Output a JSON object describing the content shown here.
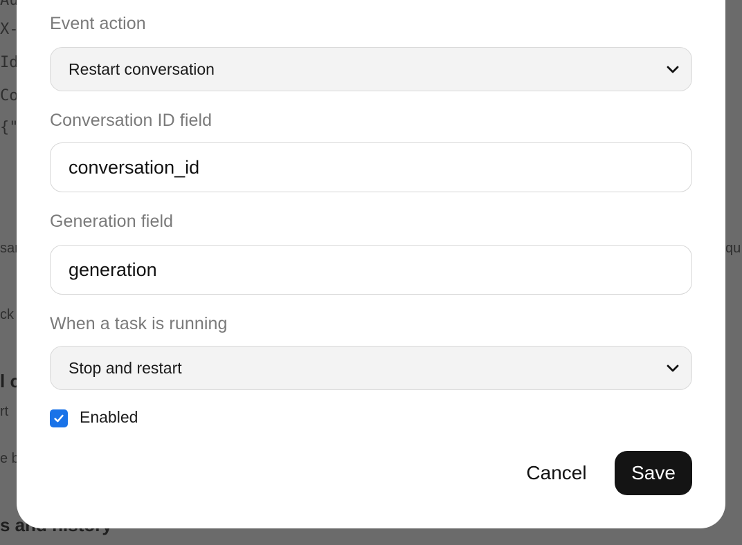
{
  "background": {
    "code_lines": [
      "Au",
      "X-",
      "Id",
      "Co",
      "{\""
    ],
    "fragments": [
      "sar",
      "qu",
      "ck",
      "l c",
      "rt",
      "e b",
      "s and history"
    ]
  },
  "modal": {
    "event_action": {
      "label": "Event action",
      "selected": "Restart conversation"
    },
    "conversation_id": {
      "label": "Conversation ID field",
      "value": "conversation_id"
    },
    "generation": {
      "label": "Generation field",
      "value": "generation"
    },
    "task_running": {
      "label": "When a task is running",
      "selected": "Stop and restart"
    },
    "enabled": {
      "label": "Enabled",
      "checked": true
    },
    "buttons": {
      "cancel": "Cancel",
      "save": "Save"
    }
  },
  "colors": {
    "overlay": "#6b6b6b",
    "checkbox": "#1a73e8",
    "save_button": "#141414"
  }
}
